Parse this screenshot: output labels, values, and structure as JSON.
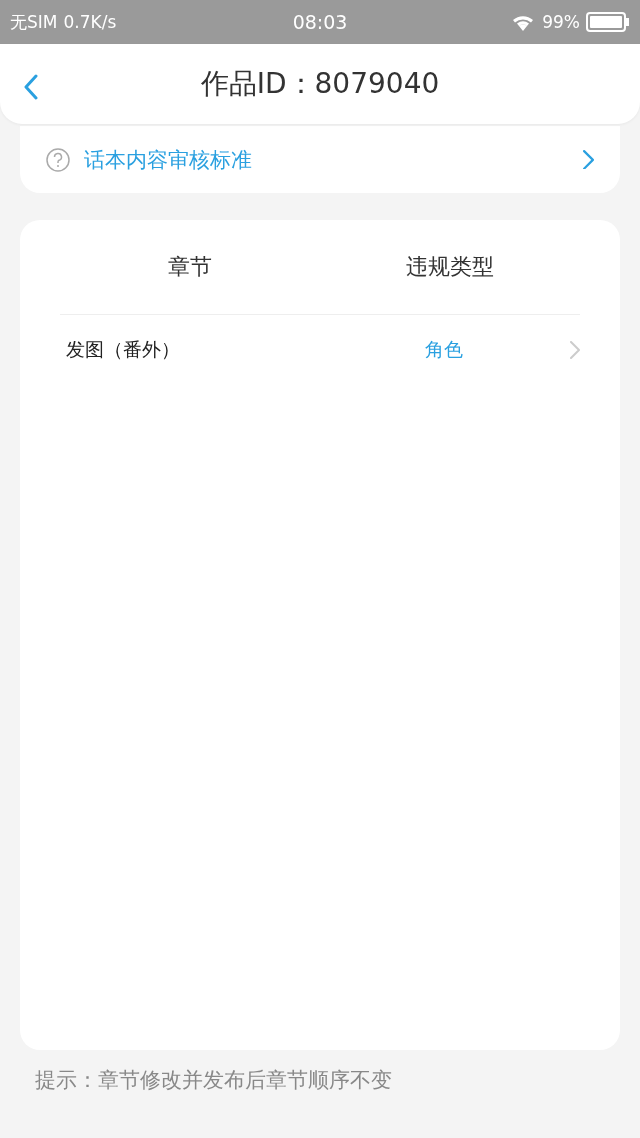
{
  "status_bar": {
    "carrier": "无SIM",
    "speed": "0.7K/s",
    "time": "08:03",
    "battery": "99%"
  },
  "header": {
    "title": "作品ID：8079040"
  },
  "guideline_link": {
    "label": "话本内容审核标准"
  },
  "table": {
    "columns": [
      "章节",
      "违规类型"
    ],
    "rows": [
      {
        "chapter": "发图（番外）",
        "violation": "角色"
      }
    ]
  },
  "hint": "提示：章节修改并发布后章节顺序不变"
}
